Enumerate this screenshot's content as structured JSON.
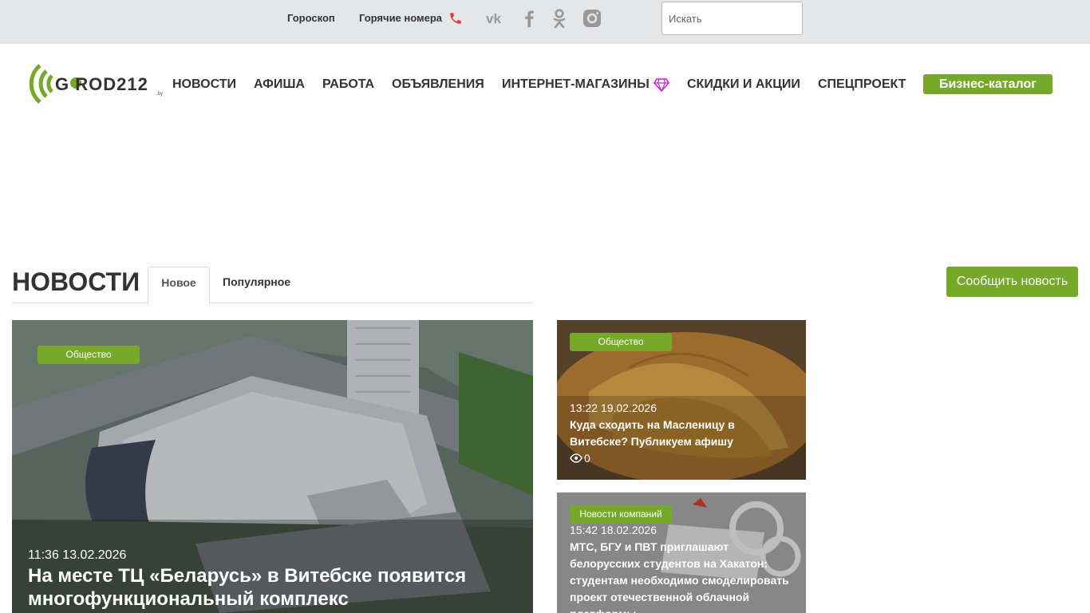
{
  "topbar": {
    "links": [
      "Гороскоп",
      "Горячие номера"
    ],
    "social_icons": [
      "vk-icon",
      "facebook-icon",
      "odnoklassniki-icon",
      "instagram-icon"
    ],
    "search_placeholder": "Искать"
  },
  "header": {
    "logo_text": "G  ROD212",
    "logo_suffix": ".by",
    "nav": [
      "Новости",
      "Афиша",
      "Работа",
      "Объявления",
      "Интернет-магазины",
      "Скидки и акции",
      "Спецпроект"
    ],
    "catalog_label": "Бизнес-каталог"
  },
  "news": {
    "title": "НОВОСТИ",
    "tabs": [
      "Новое",
      "Популярное"
    ],
    "report_label": "Сообщить новость"
  },
  "cards": [
    {
      "badge": "Общество",
      "time": "11:36 13.02.2026",
      "title": "На месте ТЦ «Беларусь» в Витебске появится многофункциональный комплекс"
    },
    {
      "badge": "Общество",
      "time": "13:22 19.02.2026",
      "title": "Куда сходить на Масленицу в Витебске? Публикуем афишу",
      "views": "0"
    },
    {
      "badge": "Новости компаний",
      "time": "15:42 18.02.2026",
      "title": "МТС, БГУ и ПВТ приглашают белорусских студентов на Хакатон: студентам необходимо смоделировать проект отечественной облачной платформы"
    }
  ],
  "colors": {
    "accent": "#76a92a",
    "topbar_bg": "#e5e6e8",
    "text": "#333333"
  }
}
